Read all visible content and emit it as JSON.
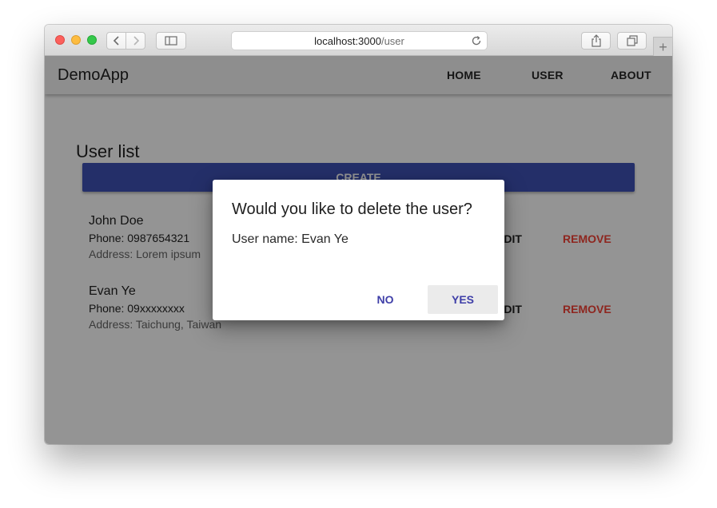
{
  "browser": {
    "url_host": "localhost:3000",
    "url_path": "/user",
    "new_tab_glyph": "+"
  },
  "app": {
    "brand": "DemoApp",
    "nav": [
      "HOME",
      "USER",
      "ABOUT"
    ]
  },
  "page": {
    "title": "User list",
    "create_label": "CREATE"
  },
  "users": [
    {
      "name": "John Doe",
      "phone": "Phone: 0987654321",
      "address": "Address: Lorem ipsum",
      "edit_label": "EDIT",
      "remove_label": "REMOVE"
    },
    {
      "name": "Evan Ye",
      "phone": "Phone: 09xxxxxxxx",
      "address": "Address: Taichung, Taiwan",
      "edit_label": "EDIT",
      "remove_label": "REMOVE"
    }
  ],
  "dialog": {
    "title": "Would you like to delete the user?",
    "body": "User name: Evan Ye",
    "no_label": "NO",
    "yes_label": "YES"
  },
  "colors": {
    "primary": "#3f51b5",
    "accent_remove": "#f44336",
    "dialog_button_text": "#3f3fa8"
  },
  "icons": [
    "close-dot",
    "minimize-dot",
    "zoom-dot",
    "chevron-left-icon",
    "chevron-right-icon",
    "sidebar-icon",
    "reload-icon",
    "share-icon",
    "tabs-icon",
    "plus-icon"
  ]
}
